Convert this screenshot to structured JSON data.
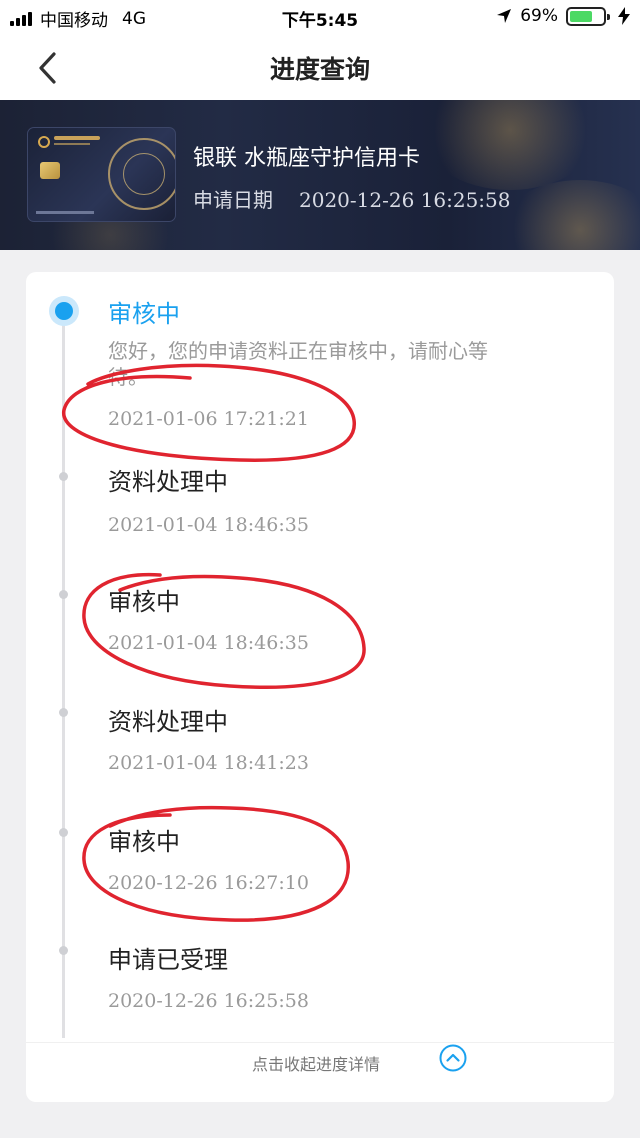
{
  "status_bar": {
    "carrier": "中国移动",
    "network": "4G",
    "time": "下午5:45",
    "battery": "69%",
    "battery_level": 0.69,
    "icons": [
      "signal-icon",
      "location-arrow-icon",
      "battery-icon",
      "charging-icon"
    ]
  },
  "nav": {
    "title": "进度查询",
    "back_icon": "chevron-left-icon"
  },
  "card": {
    "name": "银联 水瓶座守护信用卡",
    "date_label": "申请日期",
    "date_value": "2020-12-26 16:25:58"
  },
  "timeline": [
    {
      "status": "审核中",
      "message": "您好，您的申请资料正在审核中，请耐心等待。",
      "time": "2021-01-06 17:21:21",
      "active": true
    },
    {
      "status": "资料处理中",
      "time": "2021-01-04 18:46:35",
      "active": false
    },
    {
      "status": "审核中",
      "time": "2021-01-04 18:46:35",
      "active": false
    },
    {
      "status": "资料处理中",
      "time": "2021-01-04 18:41:23",
      "active": false
    },
    {
      "status": "审核中",
      "time": "2020-12-26 16:27:10",
      "active": false
    },
    {
      "status": "申请已受理",
      "time": "2020-12-26 16:25:58",
      "active": false
    }
  ],
  "collapse": {
    "label": "点击收起进度详情",
    "icon": "chevron-up-circle-icon"
  },
  "colors": {
    "accent": "#1aa1ef",
    "annotation": "#e0242f",
    "banner": "#1f2740"
  }
}
